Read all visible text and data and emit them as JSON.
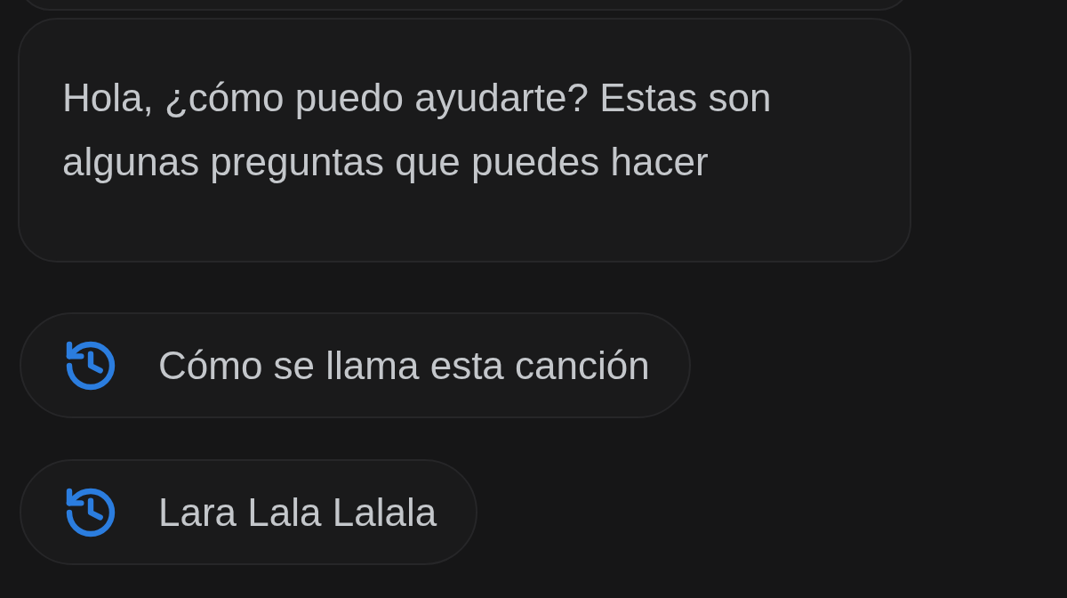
{
  "message": {
    "text": "Hola, ¿cómo puedo ayudarte? Estas son algunas preguntas que puedes hacer"
  },
  "suggestions": [
    {
      "label": "Cómo se llama esta canción"
    },
    {
      "label": "Lara Lala Lalala"
    }
  ]
}
